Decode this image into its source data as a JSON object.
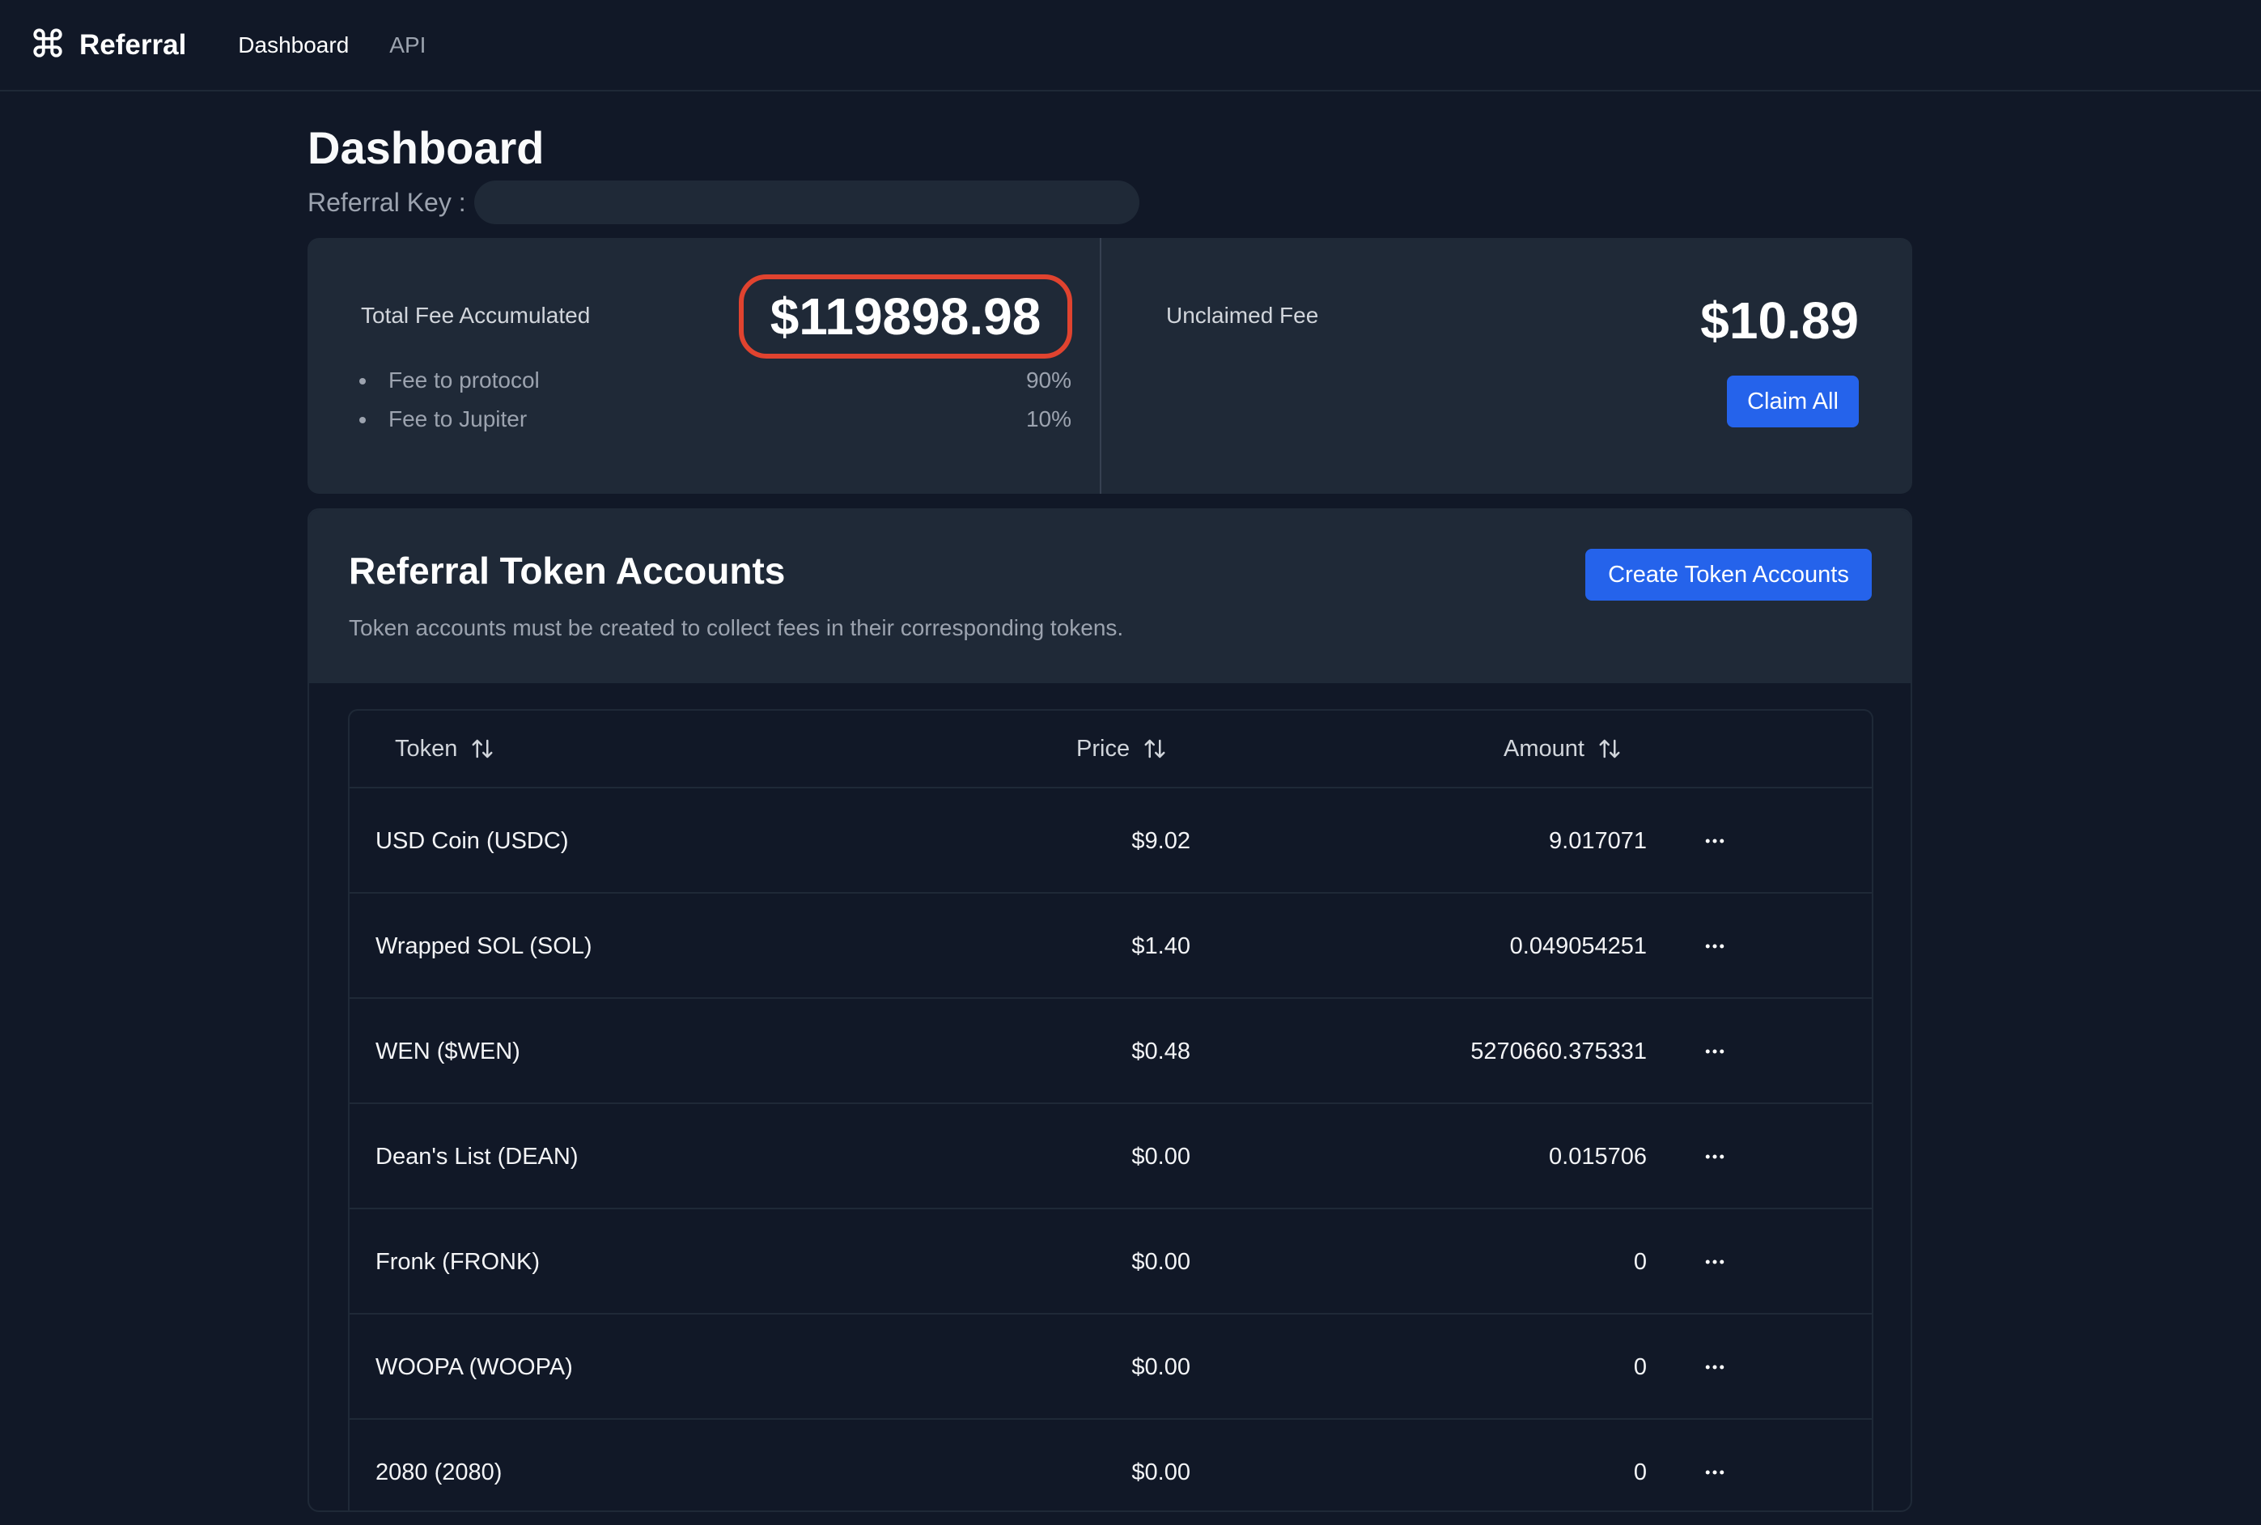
{
  "topbar": {
    "logo_icon": "command-icon",
    "app_name": "Referral",
    "nav": [
      {
        "label": "Dashboard",
        "active": true
      },
      {
        "label": "API",
        "active": false
      }
    ]
  },
  "page": {
    "title": "Dashboard",
    "referral_key_label": "Referral Key :",
    "referral_key_value": ""
  },
  "stats": {
    "total_label": "Total Fee Accumulated",
    "total_value": "$119898.98",
    "highlight_color": "#e0432f",
    "breakdown": [
      {
        "label": "Fee to protocol",
        "value": "90%"
      },
      {
        "label": "Fee to Jupiter",
        "value": "10%"
      }
    ],
    "unclaimed_label": "Unclaimed Fee",
    "unclaimed_value": "$10.89",
    "claim_button": "Claim All"
  },
  "accounts": {
    "title": "Referral Token Accounts",
    "description": "Token accounts must be created to collect fees in their corresponding tokens.",
    "create_button": "Create Token Accounts",
    "columns": [
      "Token",
      "Price",
      "Amount"
    ],
    "sort_icon": "sort-arrows-icon",
    "row_menu_icon": "more-horizontal-icon",
    "rows": [
      {
        "token": "USD Coin (USDC)",
        "price": "$9.02",
        "amount": "9.017071"
      },
      {
        "token": "Wrapped SOL (SOL)",
        "price": "$1.40",
        "amount": "0.049054251"
      },
      {
        "token": "WEN ($WEN)",
        "price": "$0.48",
        "amount": "5270660.375331"
      },
      {
        "token": "Dean's List (DEAN)",
        "price": "$0.00",
        "amount": "0.015706"
      },
      {
        "token": "Fronk (FRONK)",
        "price": "$0.00",
        "amount": "0"
      },
      {
        "token": "WOOPA (WOOPA)",
        "price": "$0.00",
        "amount": "0"
      },
      {
        "token": "2080 (2080)",
        "price": "$0.00",
        "amount": "0"
      }
    ]
  },
  "colors": {
    "background": "#111827",
    "card": "#1f2937",
    "accent": "#2563eb"
  }
}
